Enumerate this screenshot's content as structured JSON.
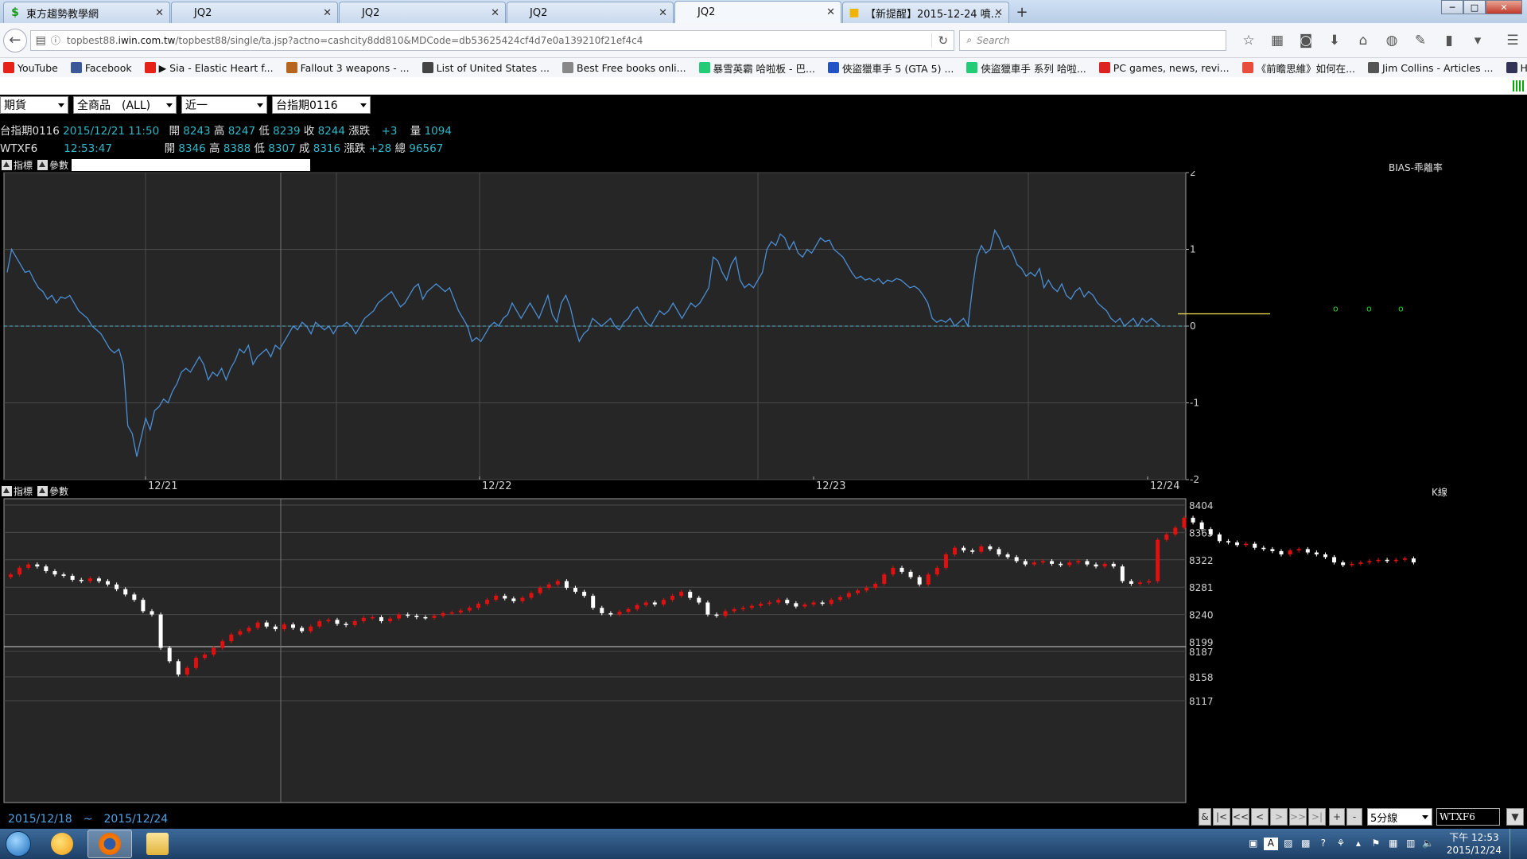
{
  "browser": {
    "tabs": [
      {
        "label": "東方趨勢教學網",
        "icon": "dollar-icon"
      },
      {
        "label": "JQ2",
        "icon": ""
      },
      {
        "label": "JQ2",
        "icon": ""
      },
      {
        "label": "JQ2",
        "icon": ""
      },
      {
        "label": "JQ2",
        "icon": "",
        "active": true
      },
      {
        "label": "【新提醒】2015-12-24 噴...",
        "icon": "forum-icon"
      }
    ],
    "new_tab": "+",
    "url_prefix": "topbest88.",
    "url_host": "iwin.com.tw",
    "url_rest": "/topbest88/single/ta.jsp?actno=cashcity8dd810&MDCode=db53625424cf4d7e0a139210f21ef4c4",
    "search_placeholder": "Search",
    "bookmarks": [
      {
        "label": "YouTube",
        "color": "#e62117"
      },
      {
        "label": "Facebook",
        "color": "#3b5998"
      },
      {
        "label": "▶ Sia - Elastic Heart f...",
        "color": "#e62117"
      },
      {
        "label": "Fallout 3 weapons - ...",
        "color": "#b5651d"
      },
      {
        "label": "List of United States ...",
        "color": "#444"
      },
      {
        "label": "Best Free books onli...",
        "color": "#888"
      },
      {
        "label": "暴雪英霸 哈啦板 - 巴...",
        "color": "#2c7"
      },
      {
        "label": "俠盜獵車手 5 (GTA 5) ...",
        "color": "#2254c7"
      },
      {
        "label": "俠盜獵車手 系列 哈啦...",
        "color": "#2c7"
      },
      {
        "label": "PC games, news, revi...",
        "color": "#d22"
      },
      {
        "label": "《前瞻思維》如何在...",
        "color": "#e74c3c"
      },
      {
        "label": "Jim Collins - Articles ...",
        "color": "#555"
      },
      {
        "label": "Heroes of the Storm ...",
        "color": "#335"
      }
    ]
  },
  "toolbar": {
    "market": "期貨",
    "product": "全商品　(ALL)",
    "contract_period": "近一",
    "contract": "台指期0116"
  },
  "quotes": [
    {
      "name": "台指期0116",
      "time": "2015/12/21 11:50",
      "open_lbl": "開",
      "open": "8243",
      "high_lbl": "高",
      "high": "8247",
      "low_lbl": "低",
      "low": "8239",
      "close_lbl": "收",
      "close": "8244",
      "chg_lbl": "漲跌",
      "chg": "+3",
      "vol_lbl": "量",
      "vol": "1094"
    },
    {
      "name": "WTXF6",
      "time": "12:53:47",
      "open_lbl": "開",
      "open": "8346",
      "high_lbl": "高",
      "high": "8388",
      "low_lbl": "低",
      "low": "8307",
      "close_lbl": "成",
      "close": "8316",
      "chg_lbl": "漲跌",
      "chg": "+28",
      "vol_lbl": "總",
      "vol": "96567"
    }
  ],
  "panels": {
    "indicator_label": "指標",
    "param_label": "參數",
    "bias_title": "BIAS-乖離率",
    "k_title": "K線"
  },
  "chart_data": [
    {
      "type": "line",
      "title": "BIAS-乖離率",
      "xlabel": "",
      "ylabel": "",
      "ylim": [
        -2,
        2
      ],
      "y_ticks": [
        "2",
        "1",
        "0",
        "-1",
        "-2"
      ],
      "x_ticks": [
        "12/21",
        "12/22",
        "12/23",
        "12/24"
      ],
      "grid": true,
      "line_color": "#4a8fd6",
      "zero_line_color": "#4fb3c8",
      "series": [
        {
          "values": [
            0.7,
            1.0,
            0.9,
            0.8,
            0.7,
            0.72,
            0.6,
            0.5,
            0.45,
            0.35,
            0.4,
            0.3,
            0.38,
            0.36,
            0.4,
            0.3,
            0.2,
            0.15,
            0.1,
            0.0,
            -0.05,
            -0.1,
            -0.2,
            -0.3,
            -0.35,
            -0.3,
            -0.5,
            -1.3,
            -1.4,
            -1.7,
            -1.45,
            -1.2,
            -1.35,
            -1.1,
            -1.05,
            -0.95,
            -1.0,
            -0.85,
            -0.75,
            -0.6,
            -0.55,
            -0.6,
            -0.5,
            -0.4,
            -0.5,
            -0.7,
            -0.6,
            -0.65,
            -0.55,
            -0.7,
            -0.55,
            -0.45,
            -0.3,
            -0.35,
            -0.25,
            -0.5,
            -0.4,
            -0.35,
            -0.3,
            -0.4,
            -0.25,
            -0.3,
            -0.2,
            -0.1,
            0.0,
            -0.05,
            0.05,
            0.0,
            -0.1,
            0.05,
            0.0,
            -0.05,
            0.0,
            -0.1,
            0.0,
            0.0,
            0.05,
            0.0,
            -0.1,
            0.0,
            0.1,
            0.15,
            0.2,
            0.3,
            0.35,
            0.4,
            0.45,
            0.35,
            0.25,
            0.3,
            0.4,
            0.5,
            0.55,
            0.35,
            0.45,
            0.5,
            0.55,
            0.5,
            0.45,
            0.5,
            0.35,
            0.2,
            0.1,
            0.0,
            -0.2,
            -0.15,
            -0.2,
            -0.1,
            0.0,
            0.05,
            0.0,
            0.1,
            0.15,
            0.3,
            0.2,
            0.1,
            0.2,
            0.3,
            0.2,
            0.1,
            0.25,
            0.4,
            0.15,
            0.05,
            0.3,
            0.4,
            0.25,
            0.0,
            -0.2,
            -0.1,
            -0.05,
            0.1,
            0.05,
            0.0,
            0.05,
            0.1,
            0.0,
            -0.05,
            0.05,
            0.1,
            0.2,
            0.25,
            0.15,
            0.05,
            0.0,
            0.1,
            0.2,
            0.15,
            0.2,
            0.3,
            0.2,
            0.1,
            0.2,
            0.3,
            0.25,
            0.3,
            0.4,
            0.5,
            0.9,
            0.85,
            0.7,
            0.6,
            0.8,
            0.9,
            0.6,
            0.5,
            0.55,
            0.5,
            0.6,
            0.7,
            1.0,
            1.1,
            1.05,
            1.2,
            1.15,
            1.0,
            1.1,
            0.95,
            0.9,
            1.0,
            0.95,
            1.05,
            1.15,
            1.1,
            1.12,
            1.0,
            0.95,
            0.9,
            0.8,
            0.7,
            0.62,
            0.65,
            0.6,
            0.62,
            0.58,
            0.62,
            0.55,
            0.6,
            0.58,
            0.62,
            0.6,
            0.55,
            0.5,
            0.52,
            0.48,
            0.4,
            0.3,
            0.1,
            0.05,
            0.08,
            0.05,
            0.1,
            0.0,
            0.05,
            0.1,
            0.0,
            0.5,
            0.9,
            1.05,
            0.95,
            1.0,
            1.25,
            1.15,
            1.0,
            1.05,
            0.95,
            0.8,
            0.75,
            0.65,
            0.7,
            0.65,
            0.75,
            0.5,
            0.6,
            0.5,
            0.45,
            0.55,
            0.4,
            0.35,
            0.45,
            0.5,
            0.38,
            0.45,
            0.4,
            0.3,
            0.25,
            0.2,
            0.1,
            0.05,
            0.1,
            0.0,
            0.05,
            0.1,
            0.0,
            0.1,
            0.05,
            0.1,
            0.05,
            0.0
          ]
        }
      ],
      "overlay_level": 0.16,
      "overlay_color": "#e2d14a",
      "markers": [
        "o",
        "o",
        "o",
        "o"
      ]
    },
    {
      "type": "candlestick",
      "title": "K線",
      "xlabel": "",
      "ylabel": "",
      "ylim": [
        8117,
        8415
      ],
      "y_ticks": [
        "8404",
        "8363",
        "8322",
        "8281",
        "8240",
        "8199",
        "8187",
        "8158",
        "8117"
      ],
      "grid": true,
      "up_color": "#e01010",
      "down_color": "#ffffff",
      "series": [
        {
          "closes": [
            8300,
            8310,
            8315,
            8312,
            8305,
            8300,
            8298,
            8292,
            8290,
            8294,
            8290,
            8285,
            8278,
            8270,
            8262,
            8245,
            8240,
            8190,
            8170,
            8150,
            8160,
            8175,
            8180,
            8190,
            8200,
            8210,
            8215,
            8220,
            8228,
            8222,
            8218,
            8225,
            8220,
            8215,
            8222,
            8230,
            8232,
            8226,
            8224,
            8230,
            8235,
            8236,
            8230,
            8234,
            8240,
            8238,
            8236,
            8235,
            8238,
            8242,
            8243,
            8246,
            8250,
            8256,
            8262,
            8268,
            8264,
            8260,
            8265,
            8272,
            8280,
            8285,
            8290,
            8280,
            8274,
            8268,
            8250,
            8242,
            8240,
            8244,
            8248,
            8254,
            8258,
            8255,
            8262,
            8268,
            8274,
            8265,
            8258,
            8240,
            8238,
            8245,
            8248,
            8250,
            8253,
            8256,
            8258,
            8262,
            8257,
            8252,
            8255,
            8258,
            8256,
            8262,
            8266,
            8272,
            8276,
            8280,
            8286,
            8300,
            8310,
            8304,
            8296,
            8285,
            8300,
            8310,
            8330,
            8340,
            8336,
            8334,
            8342,
            8338,
            8330,
            8326,
            8320,
            8315,
            8318,
            8320,
            8316,
            8314,
            8318,
            8320,
            8315,
            8312,
            8316,
            8312,
            8290,
            8286,
            8288,
            8290,
            8352,
            8360,
            8370,
            8385,
            8378,
            8368,
            8360,
            8350,
            8348,
            8344,
            8346,
            8340,
            8338,
            8335,
            8330,
            8336,
            8338,
            8333,
            8330,
            8326,
            8318,
            8314,
            8316,
            8318,
            8320,
            8322,
            8320,
            8322,
            8324,
            8318
          ]
        }
      ]
    }
  ],
  "bottom": {
    "range_start": "2015/12/18",
    "tilde": "~",
    "range_end": "2015/12/24",
    "btn_amp": "&",
    "btn_first": "|<",
    "btn_prev_page": "<<",
    "btn_prev": "<",
    "btn_next": ">",
    "btn_next_page": ">>",
    "btn_last": ">|",
    "btn_plus": "+",
    "btn_minus": "-",
    "interval": "5分線",
    "symbol": "WTXF6"
  },
  "taskbar": {
    "time": "下午 12:53",
    "date": "2015/12/24"
  }
}
